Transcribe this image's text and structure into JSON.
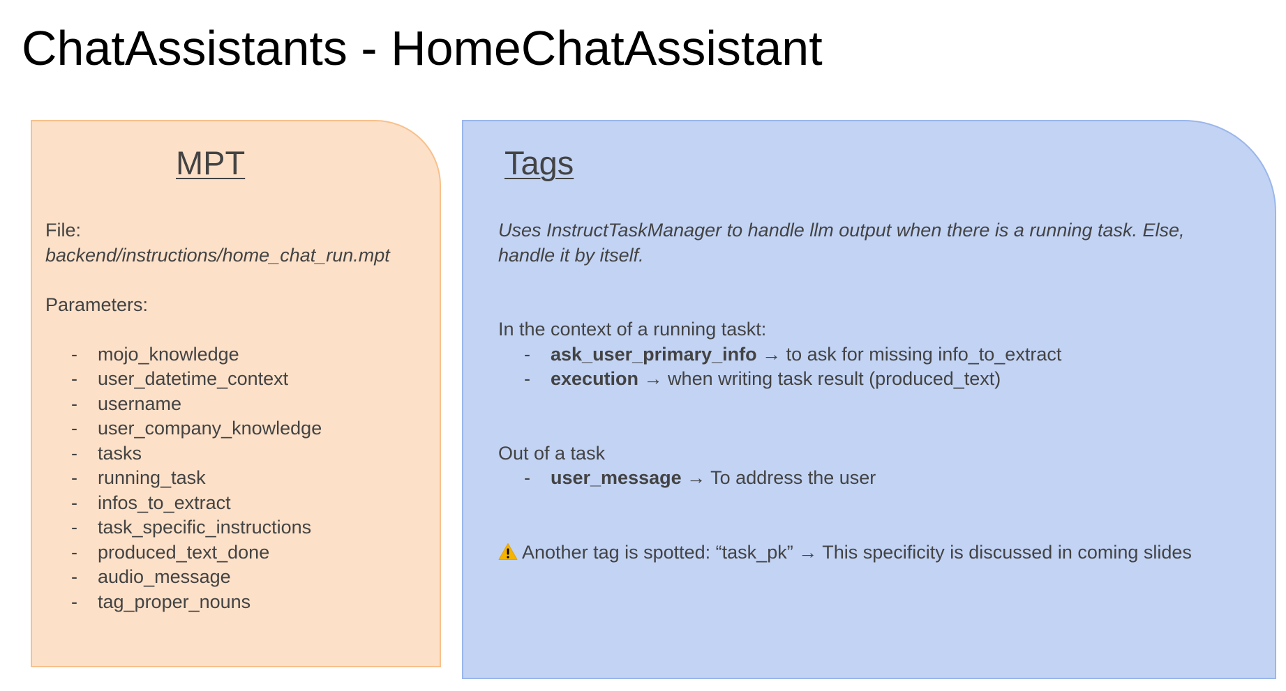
{
  "slide": {
    "title": "ChatAssistants - HomeChatAssistant"
  },
  "mpt_panel": {
    "heading": "MPT",
    "file_label": "File:",
    "file_path": "backend/instructions/home_chat_run.mpt",
    "parameters_label": "Parameters:",
    "bullet": "-",
    "parameters": [
      "mojo_knowledge",
      "user_datetime_context",
      "username",
      "user_company_knowledge",
      "tasks",
      "running_task",
      "infos_to_extract",
      "task_specific_instructions",
      "produced_text_done",
      "audio_message",
      "tag_proper_nouns"
    ]
  },
  "tags_panel": {
    "heading": "Tags",
    "description_line1": "Uses InstructTaskManager to handle llm output when there is a running task. Else,",
    "description_line2": "handle it by itself.",
    "running_task_label": "In the context of a running taskt:",
    "running_task_tags": [
      {
        "tag": "ask_user_primary_info",
        "desc": " → to ask for missing info_to_extract"
      },
      {
        "tag": "execution",
        "desc": " → when writing task result (produced_text)"
      }
    ],
    "out_of_task_label": "Out of a task",
    "out_of_task_tags": [
      {
        "tag": "user_message",
        "desc": " → To address the user"
      }
    ],
    "warning_icon": "warning-icon",
    "warning_text": "Another tag is spotted: “task_pk” → This specificity is discussed in coming slides"
  },
  "colors": {
    "mpt_fill": "#fce0c8",
    "mpt_border": "#f8c08c",
    "tags_fill": "#c2d3f4",
    "tags_border": "#9bb6ea",
    "text": "#434343",
    "title": "#000000",
    "warning": "#f5b400"
  }
}
